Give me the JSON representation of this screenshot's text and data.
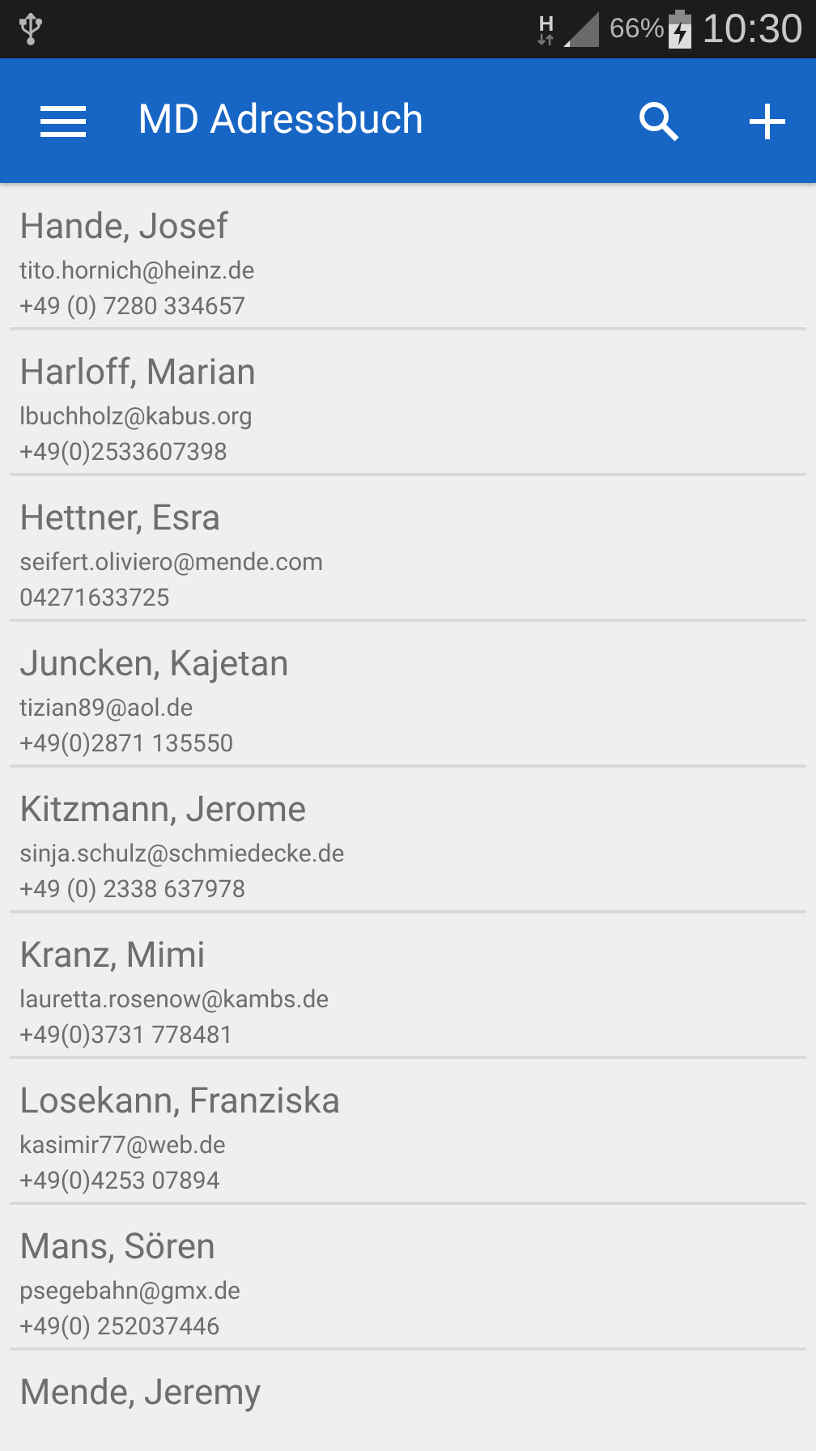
{
  "status_bar": {
    "network_type": "H",
    "battery": "66%",
    "time": "10:30"
  },
  "app_bar": {
    "title": "MD Adressbuch"
  },
  "contacts": [
    {
      "name": "Hande, Josef",
      "email": "tito.hornich@heinz.de",
      "phone": "+49 (0) 7280 334657"
    },
    {
      "name": "Harloff, Marian",
      "email": "lbuchholz@kabus.org",
      "phone": "+49(0)2533607398"
    },
    {
      "name": "Hettner, Esra",
      "email": "seifert.oliviero@mende.com",
      "phone": "04271633725"
    },
    {
      "name": "Juncken, Kajetan",
      "email": "tizian89@aol.de",
      "phone": "+49(0)2871 135550"
    },
    {
      "name": "Kitzmann, Jerome",
      "email": "sinja.schulz@schmiedecke.de",
      "phone": "+49 (0) 2338 637978"
    },
    {
      "name": "Kranz, Mimi",
      "email": "lauretta.rosenow@kambs.de",
      "phone": "+49(0)3731 778481"
    },
    {
      "name": "Losekann, Franziska",
      "email": "kasimir77@web.de",
      "phone": "+49(0)4253 07894"
    },
    {
      "name": "Mans, Sören",
      "email": "psegebahn@gmx.de",
      "phone": "+49(0) 252037446"
    },
    {
      "name": "Mende, Jeremy"
    }
  ]
}
